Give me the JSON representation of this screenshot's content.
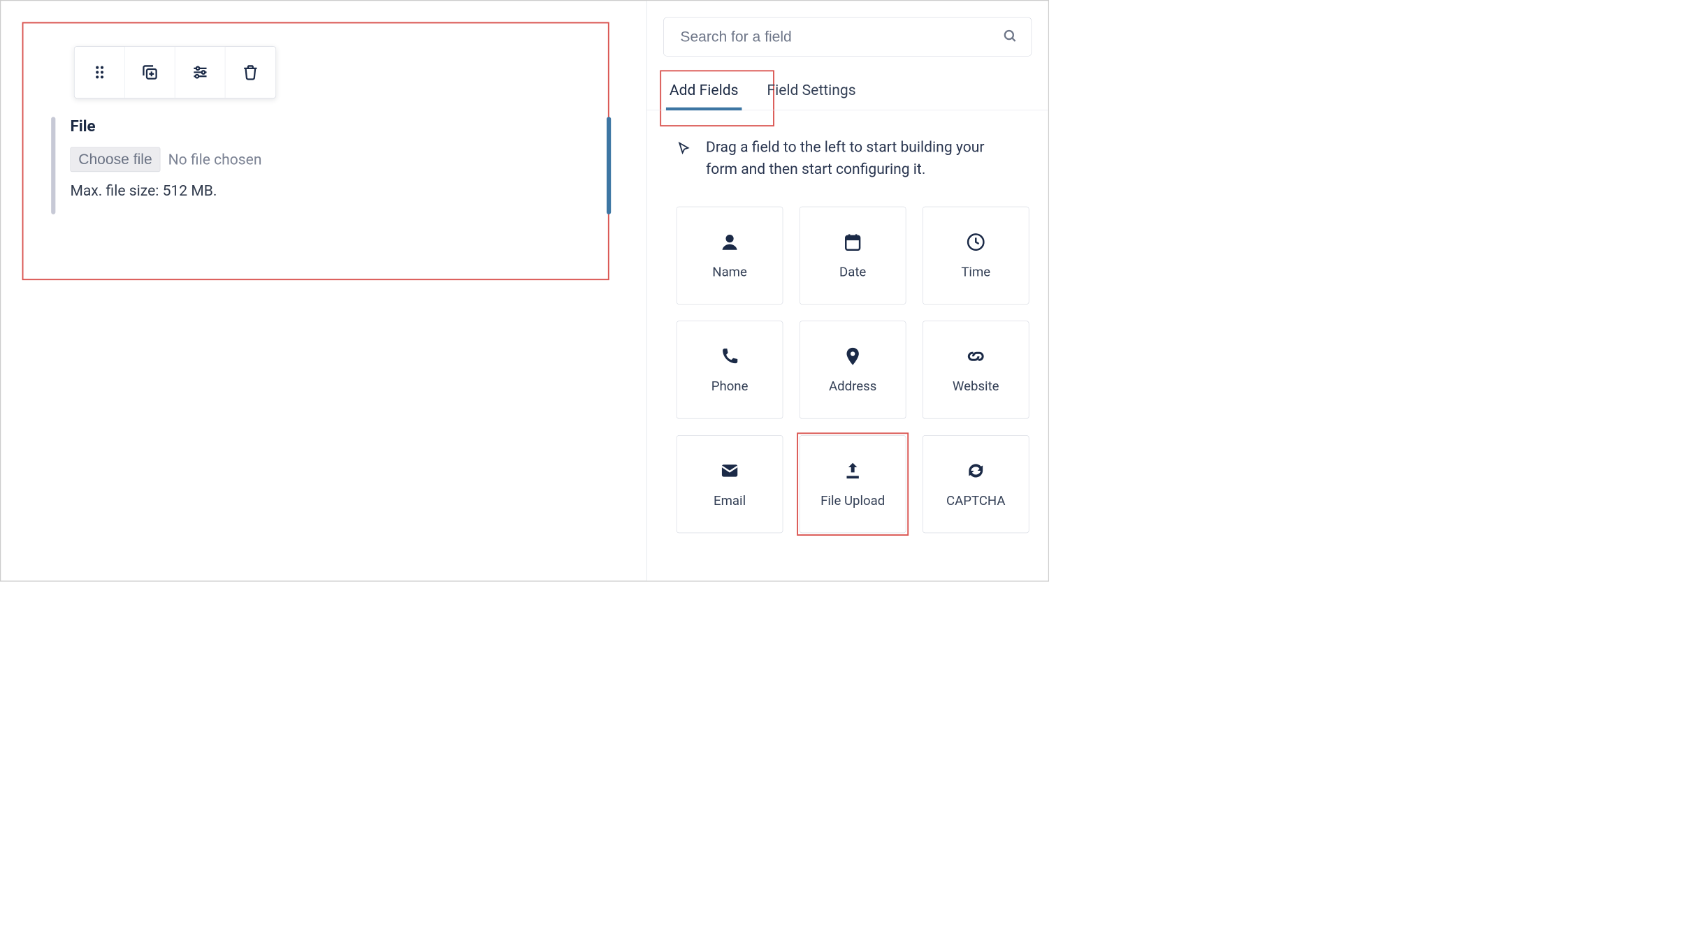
{
  "canvas": {
    "field": {
      "title": "File",
      "choose_label": "Choose file",
      "status_text": "No file chosen",
      "hint": "Max. file size: 512 MB."
    },
    "toolbar": {
      "drag": "drag-handle",
      "duplicate": "duplicate",
      "settings": "settings",
      "delete": "delete"
    }
  },
  "sidebar": {
    "search_placeholder": "Search for a field",
    "tabs": {
      "add_fields": "Add Fields",
      "field_settings": "Field Settings"
    },
    "instruction": "Drag a field to the left to start building your form and then start configuring it.",
    "fields": [
      {
        "id": "name",
        "label": "Name",
        "icon": "person"
      },
      {
        "id": "date",
        "label": "Date",
        "icon": "calendar"
      },
      {
        "id": "time",
        "label": "Time",
        "icon": "clock"
      },
      {
        "id": "phone",
        "label": "Phone",
        "icon": "phone"
      },
      {
        "id": "address",
        "label": "Address",
        "icon": "pin"
      },
      {
        "id": "website",
        "label": "Website",
        "icon": "link"
      },
      {
        "id": "email",
        "label": "Email",
        "icon": "mail"
      },
      {
        "id": "file-upload",
        "label": "File Upload",
        "icon": "upload"
      },
      {
        "id": "captcha",
        "label": "CAPTCHA",
        "icon": "refresh"
      }
    ],
    "highlighted_field": "file-upload"
  },
  "colors": {
    "highlight": "#d9534f",
    "accent": "#3d76a3",
    "text_dark": "#1b2a47"
  }
}
